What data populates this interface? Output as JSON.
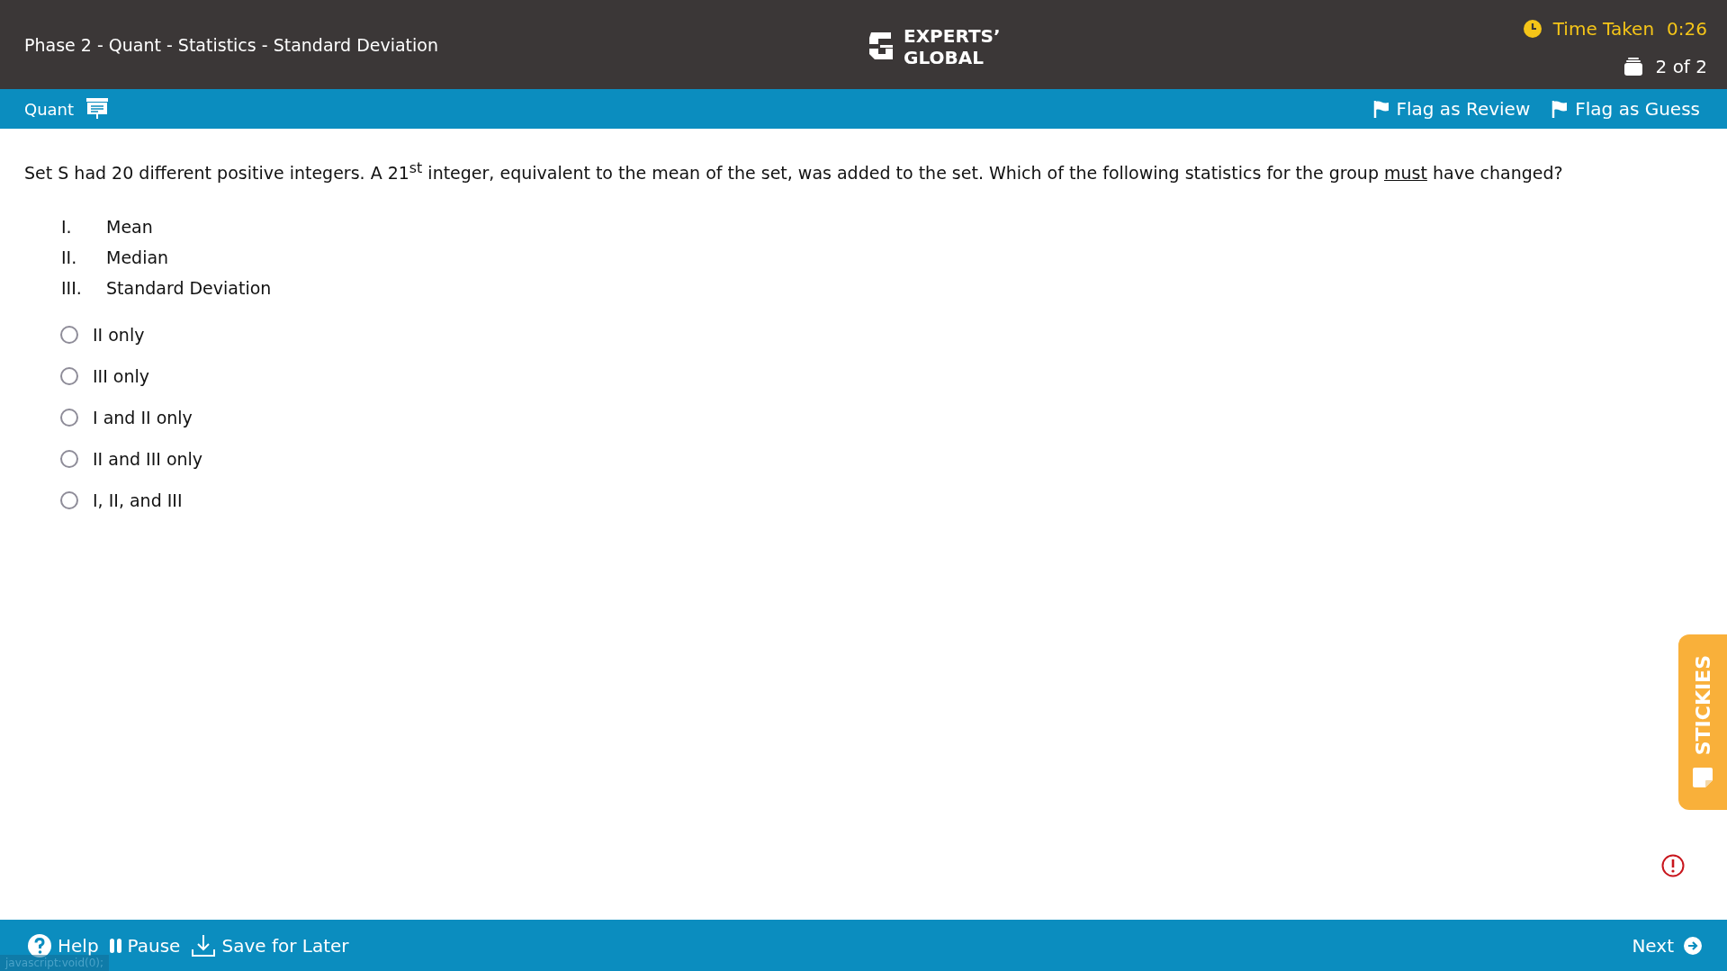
{
  "header": {
    "title": "Phase 2 - Quant - Statistics - Standard Deviation",
    "logo_lines": [
      "EXPERTS’",
      "GLOBAL"
    ],
    "timer_label": "Time Taken",
    "timer_value": "0:26",
    "progress": "2 of 2"
  },
  "section_bar": {
    "section": "Quant",
    "flags": [
      {
        "label": "Flag as Review"
      },
      {
        "label": "Flag as Guess"
      }
    ]
  },
  "question": {
    "segments": [
      {
        "text": "Set S had 20 different positive integers. A 21$^{st}$ integer, equivalent to the mean of the set, was added to the set. Which of the following statistics for the group ",
        "underline": false
      },
      {
        "text": "must",
        "underline": true
      },
      {
        "text": " have changed?",
        "underline": false
      }
    ],
    "statements": [
      {
        "numeral": "I.",
        "text": "Mean"
      },
      {
        "numeral": "II.",
        "text": "Median"
      },
      {
        "numeral": "III.",
        "text": "Standard Deviation"
      }
    ],
    "options": [
      {
        "label": "II only",
        "selected": false
      },
      {
        "label": "III only",
        "selected": false
      },
      {
        "label": "I and II only",
        "selected": false
      },
      {
        "label": "II and III only",
        "selected": false
      },
      {
        "label": "I, II, and III",
        "selected": false
      }
    ]
  },
  "stickies": {
    "label": "STICKIES"
  },
  "footer": {
    "buttons": [
      {
        "kind": "help",
        "label": "Help"
      },
      {
        "kind": "pause",
        "label": "Pause"
      },
      {
        "kind": "save",
        "label": "Save for Later"
      }
    ],
    "next": "Next"
  },
  "status_text": "javascript:void(0);"
}
